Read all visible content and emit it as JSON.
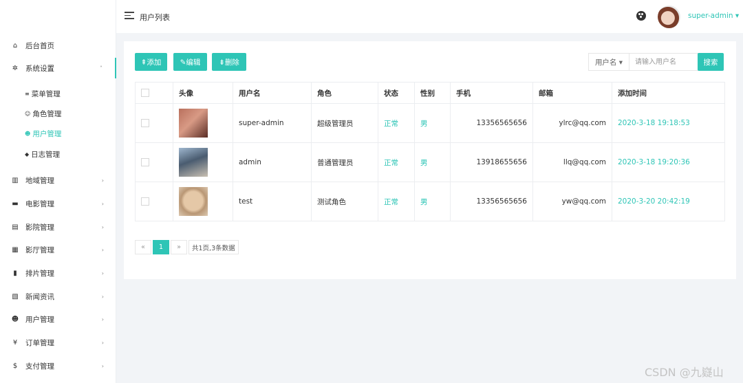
{
  "sidebar": {
    "items": [
      {
        "label": "后台首页",
        "icon": "home-icon",
        "glyph": "⌂"
      },
      {
        "label": "系统设置",
        "icon": "gear-icon",
        "glyph": "✲"
      },
      {
        "label": "地域管理",
        "icon": "map-icon",
        "glyph": "▥"
      },
      {
        "label": "电影管理",
        "icon": "film-icon",
        "glyph": "▬"
      },
      {
        "label": "影院管理",
        "icon": "cinema-icon",
        "glyph": "▤"
      },
      {
        "label": "影厅管理",
        "icon": "hall-icon",
        "glyph": "▦"
      },
      {
        "label": "排片管理",
        "icon": "schedule-icon",
        "glyph": "▮"
      },
      {
        "label": "新闻资讯",
        "icon": "news-icon",
        "glyph": "▧"
      },
      {
        "label": "用户管理",
        "icon": "users-icon",
        "glyph": "☻"
      },
      {
        "label": "订单管理",
        "icon": "yen-icon",
        "glyph": "¥"
      },
      {
        "label": "支付管理",
        "icon": "dollar-icon",
        "glyph": "$"
      }
    ],
    "sub_items": [
      {
        "label": "菜单管理",
        "icon": "list-icon",
        "glyph": "≡"
      },
      {
        "label": "角色管理",
        "icon": "role-icon",
        "glyph": "☺"
      },
      {
        "label": "用户管理",
        "icon": "user-group-icon",
        "glyph": "☻"
      },
      {
        "label": "日志管理",
        "icon": "tag-icon",
        "glyph": "◆"
      }
    ]
  },
  "topbar": {
    "title": "用户列表",
    "username": "super-admin ▾"
  },
  "toolbar": {
    "add": "⇞添加",
    "edit": "✎编辑",
    "delete": "⇟删除"
  },
  "search": {
    "field": "用户名 ▾",
    "placeholder": "请输入用户名",
    "button": "搜索"
  },
  "table": {
    "headers": [
      "头像",
      "用户名",
      "角色",
      "状态",
      "性别",
      "手机",
      "邮箱",
      "添加时间"
    ],
    "rows": [
      {
        "username": "super-admin",
        "role": "超级管理员",
        "status": "正常",
        "gender": "男",
        "phone": "13356565656",
        "email": "ylrc@qq.com",
        "time": "2020-3-18 19:18:53"
      },
      {
        "username": "admin",
        "role": "普通管理员",
        "status": "正常",
        "gender": "男",
        "phone": "13918655656",
        "email": "llq@qq.com",
        "time": "2020-3-18 19:20:36"
      },
      {
        "username": "test",
        "role": "测试角色",
        "status": "正常",
        "gender": "男",
        "phone": "13356565656",
        "email": "yw@qq.com",
        "time": "2020-3-20 20:42:19"
      }
    ]
  },
  "pager": {
    "prev": "«",
    "current": "1",
    "next": "»",
    "summary": "共1页,3条数据"
  },
  "watermark": "CSDN @九嶷山",
  "colors": {
    "accent": "#2ec5b6"
  }
}
